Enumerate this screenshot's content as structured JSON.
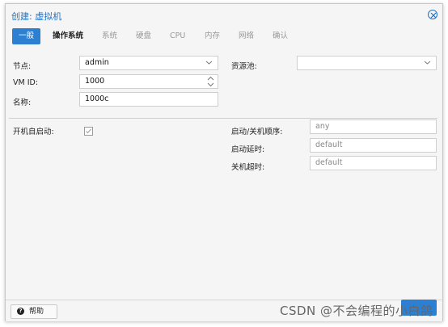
{
  "dialog": {
    "title": "创建: 虚拟机",
    "close_icon": "close-circle-icon",
    "accent_color": "#2c7fd1"
  },
  "tabs": [
    {
      "label": "一般"
    },
    {
      "label": "操作系统"
    },
    {
      "label": "系统"
    },
    {
      "label": "硬盘"
    },
    {
      "label": "CPU"
    },
    {
      "label": "内存"
    },
    {
      "label": "网络"
    },
    {
      "label": "确认"
    }
  ],
  "form": {
    "node_label": "节点:",
    "node_value": "admin",
    "vmid_label": "VM ID:",
    "vmid_value": "1000",
    "name_label": "名称:",
    "name_value": "1000c",
    "pool_label": "资源池:",
    "pool_value": "",
    "autostart_label": "开机自启动:",
    "autostart_checked": false,
    "order_label": "启动/关机顺序:",
    "order_placeholder": "any",
    "startup_delay_label": "启动延时:",
    "startup_delay_placeholder": "default",
    "shutdown_timeout_label": "关机超时:",
    "shutdown_timeout_placeholder": "default"
  },
  "footer": {
    "help_label": "帮助",
    "help_icon": "question-circle-icon"
  },
  "watermark": "CSDN @不会编程的小白鸽"
}
